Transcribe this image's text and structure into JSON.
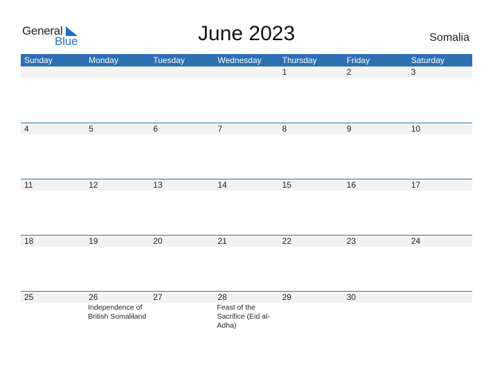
{
  "logo": {
    "line1": "General",
    "line2": "Blue"
  },
  "title": "June 2023",
  "country": "Somalia",
  "weekdays": [
    "Sunday",
    "Monday",
    "Tuesday",
    "Wednesday",
    "Thursday",
    "Friday",
    "Saturday"
  ],
  "weeks": [
    {
      "days": [
        "",
        "",
        "",
        "",
        "1",
        "2",
        "3"
      ],
      "events": [
        "",
        "",
        "",
        "",
        "",
        "",
        ""
      ]
    },
    {
      "days": [
        "4",
        "5",
        "6",
        "7",
        "8",
        "9",
        "10"
      ],
      "events": [
        "",
        "",
        "",
        "",
        "",
        "",
        ""
      ]
    },
    {
      "days": [
        "11",
        "12",
        "13",
        "14",
        "15",
        "16",
        "17"
      ],
      "events": [
        "",
        "",
        "",
        "",
        "",
        "",
        ""
      ]
    },
    {
      "days": [
        "18",
        "19",
        "20",
        "21",
        "22",
        "23",
        "24"
      ],
      "events": [
        "",
        "",
        "",
        "",
        "",
        "",
        ""
      ]
    },
    {
      "days": [
        "25",
        "26",
        "27",
        "28",
        "29",
        "30",
        ""
      ],
      "events": [
        "",
        "Independence of British Somaliland",
        "",
        "Feast of the Sacrifice (Eid al-Adha)",
        "",
        "",
        ""
      ]
    }
  ],
  "colors": {
    "header": "#2e6fb2",
    "brand_blue": "#1c74c4",
    "day_row": "#f2f2f2"
  }
}
